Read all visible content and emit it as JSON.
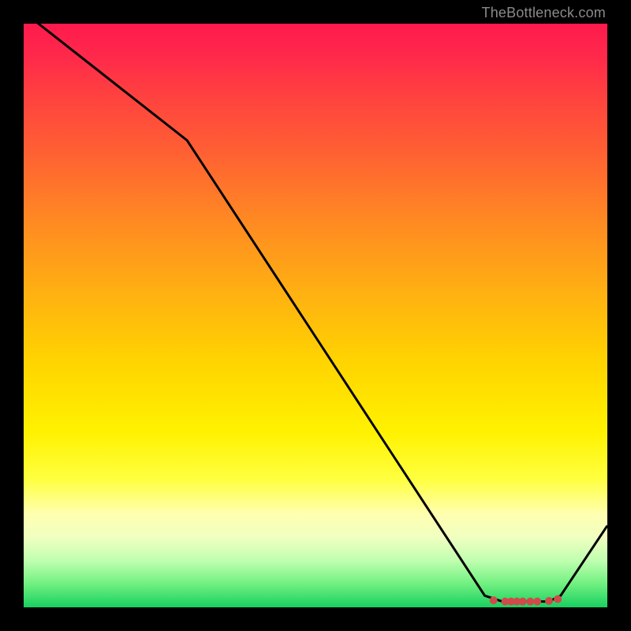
{
  "watermark": "TheBottleneck.com",
  "chart_data": {
    "type": "line",
    "title": "",
    "xlabel": "",
    "ylabel": "",
    "xlim": [
      0,
      100
    ],
    "ylim": [
      0,
      100
    ],
    "background": "heatmap-gradient",
    "series": [
      {
        "name": "curve",
        "points": [
          {
            "x": 0,
            "y": 102
          },
          {
            "x": 28,
            "y": 80
          },
          {
            "x": 79,
            "y": 2
          },
          {
            "x": 82,
            "y": 1
          },
          {
            "x": 90,
            "y": 1
          },
          {
            "x": 92,
            "y": 2
          },
          {
            "x": 100,
            "y": 14
          }
        ],
        "color": "#000000",
        "width": 3
      },
      {
        "name": "markers",
        "points": [
          {
            "x": 80.5,
            "y": 1.2
          },
          {
            "x": 82.5,
            "y": 1.0
          },
          {
            "x": 83.5,
            "y": 1.0
          },
          {
            "x": 84.5,
            "y": 1.0
          },
          {
            "x": 85.5,
            "y": 1.0
          },
          {
            "x": 86.8,
            "y": 1.0
          },
          {
            "x": 88.0,
            "y": 1.0
          },
          {
            "x": 90.0,
            "y": 1.1
          },
          {
            "x": 91.5,
            "y": 1.4
          }
        ],
        "color": "#d14a4a",
        "size": 5
      }
    ]
  }
}
